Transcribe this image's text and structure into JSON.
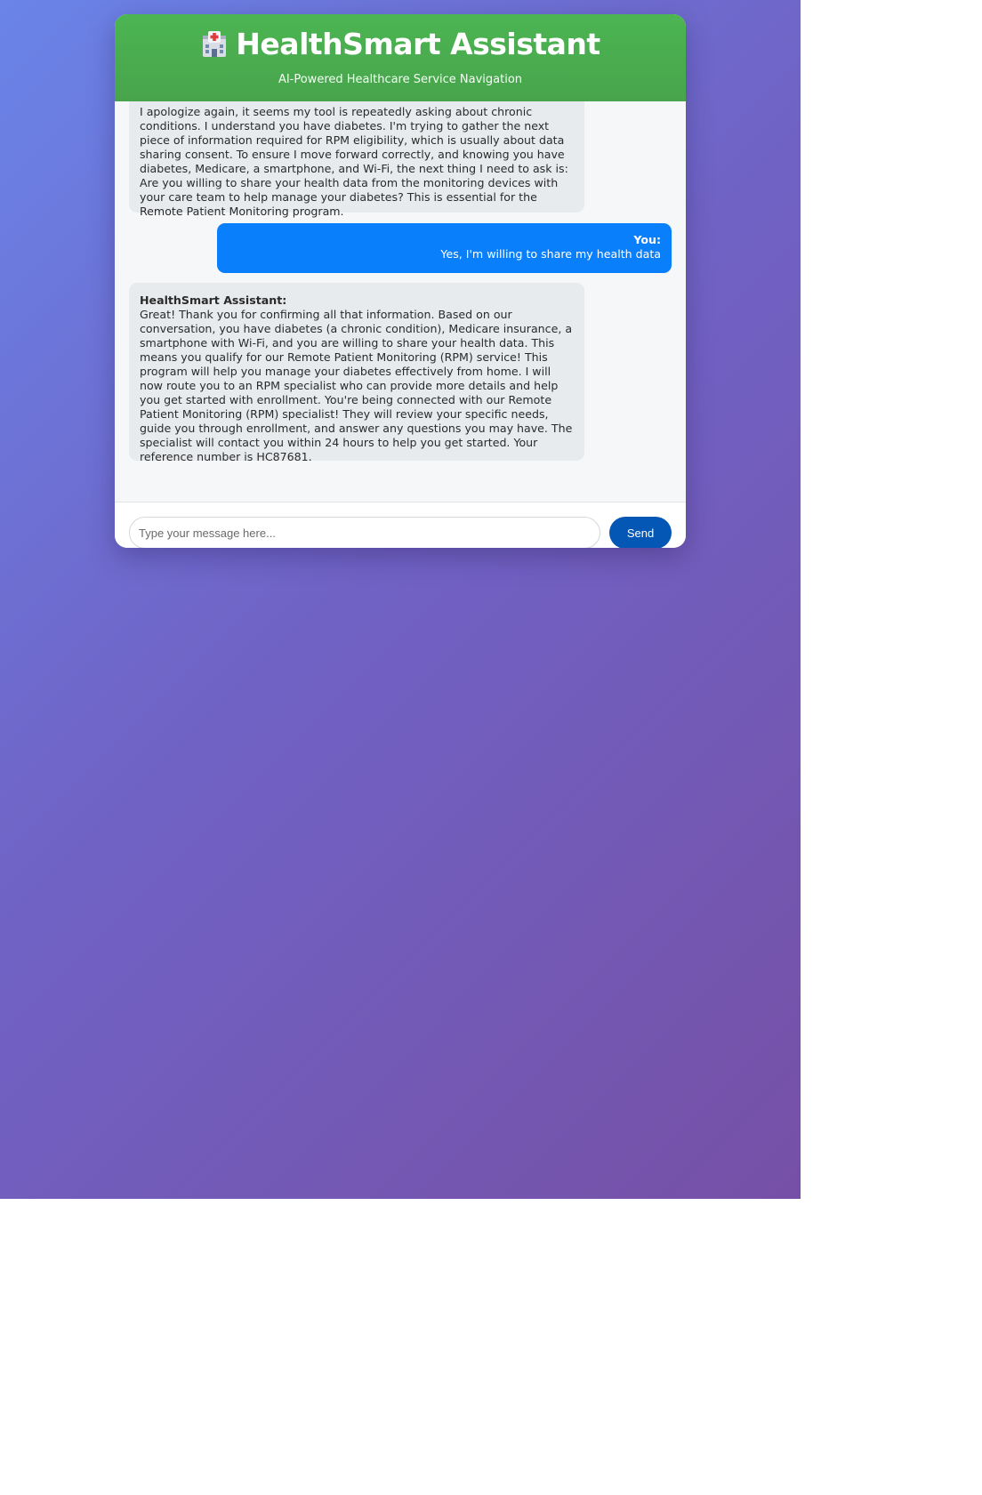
{
  "header": {
    "title": "HealthSmart Assistant",
    "subtitle": "AI-Powered Healthcare Service Navigation",
    "icon": "hospital-icon",
    "color": "#4caf50"
  },
  "messages": [
    {
      "role": "assistant",
      "sender": "",
      "text": "I apologize again, it seems my tool is repeatedly asking about chronic conditions. I understand you have diabetes. I'm trying to gather the next piece of information required for RPM eligibility, which is usually about data sharing consent. To ensure I move forward correctly, and knowing you have diabetes, Medicare, a smartphone, and Wi-Fi, the next thing I need to ask is: Are you willing to share your health data from the monitoring devices with your care team to help manage your diabetes? This is essential for the Remote Patient Monitoring program."
    },
    {
      "role": "user",
      "sender": "You:",
      "text": "Yes, I'm willing to share my health data"
    },
    {
      "role": "assistant",
      "sender": "HealthSmart Assistant:",
      "text": "Great! Thank you for confirming all that information. Based on our conversation, you have diabetes (a chronic condition), Medicare insurance, a smartphone with Wi-Fi, and you are willing to share your health data. This means you qualify for our Remote Patient Monitoring (RPM) service! This program will help you manage your diabetes effectively from home. I will now route you to an RPM specialist who can provide more details and help you get started with enrollment. You're being connected with our Remote Patient Monitoring (RPM) specialist! They will review your specific needs, guide you through enrollment, and answer any questions you may have. The specialist will contact you within 24 hours to help you get started. Your reference number is HC87681."
    }
  ],
  "input": {
    "placeholder": "Type your message here...",
    "value": ""
  },
  "send_button": {
    "label": "Send",
    "color": "#0457b4"
  },
  "colors": {
    "user_bubble": "#0a7ffb",
    "assistant_bubble": "#e8ebee",
    "background_gradient_start": "#6a84e8",
    "background_gradient_end": "#7650a6"
  }
}
